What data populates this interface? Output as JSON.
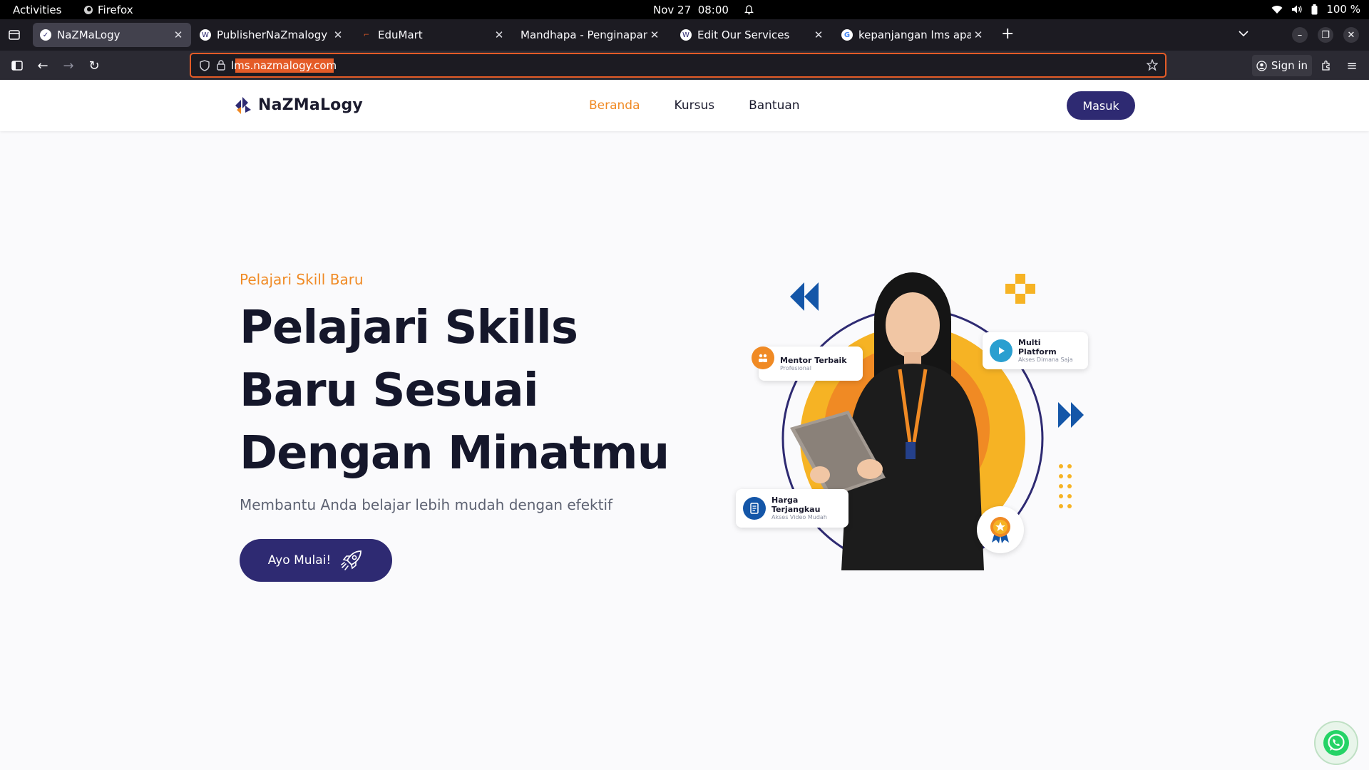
{
  "system": {
    "activities": "Activities",
    "app_name": "Firefox",
    "date": "Nov 27",
    "time": "08:00",
    "battery": "100 %"
  },
  "browser": {
    "tabs": [
      {
        "title": "NaZMaLogy",
        "active": true
      },
      {
        "title": "PublisherNaZmalogy",
        "active": false
      },
      {
        "title": "EduMart",
        "active": false
      },
      {
        "title": "Mandhapa - Penginapan Indonesia",
        "active": false
      },
      {
        "title": "Edit Our Services",
        "active": false
      },
      {
        "title": "kepanjangan lms apa - Penelusuran Google",
        "active": false
      }
    ],
    "url": "lms.nazmalogy.com",
    "sign_in": "Sign in"
  },
  "site": {
    "brand": "NaZMaLogy",
    "nav": [
      {
        "label": "Beranda",
        "active": true
      },
      {
        "label": "Kursus",
        "active": false
      },
      {
        "label": "Bantuan",
        "active": false
      }
    ],
    "login_button": "Masuk",
    "hero": {
      "kicker": "Pelajari Skill Baru",
      "headline": "Pelajari Skills Baru Sesuai Dengan Minatmu",
      "subtitle": "Membantu Anda belajar lebih mudah dengan efektif",
      "cta": "Ayo Mulai!"
    },
    "features": {
      "mentor": {
        "title": "Mentor Terbaik",
        "sub": "Profesional"
      },
      "platform": {
        "title": "Multi Platform",
        "sub": "Akses Dimana Saja"
      },
      "price": {
        "title": "Harga Terjangkau",
        "sub": "Akses Video Mudah"
      }
    }
  },
  "colors": {
    "primary": "#2e2a72",
    "accent": "#f08a24",
    "yellow": "#f6b324",
    "blue": "#1456a8",
    "whatsapp": "#25d366"
  },
  "icons": {
    "mentor": "mentor-icon",
    "platform": "play-icon",
    "price": "document-icon",
    "award": "award-icon",
    "cta": "rocket-icon",
    "chat": "whatsapp-icon"
  }
}
